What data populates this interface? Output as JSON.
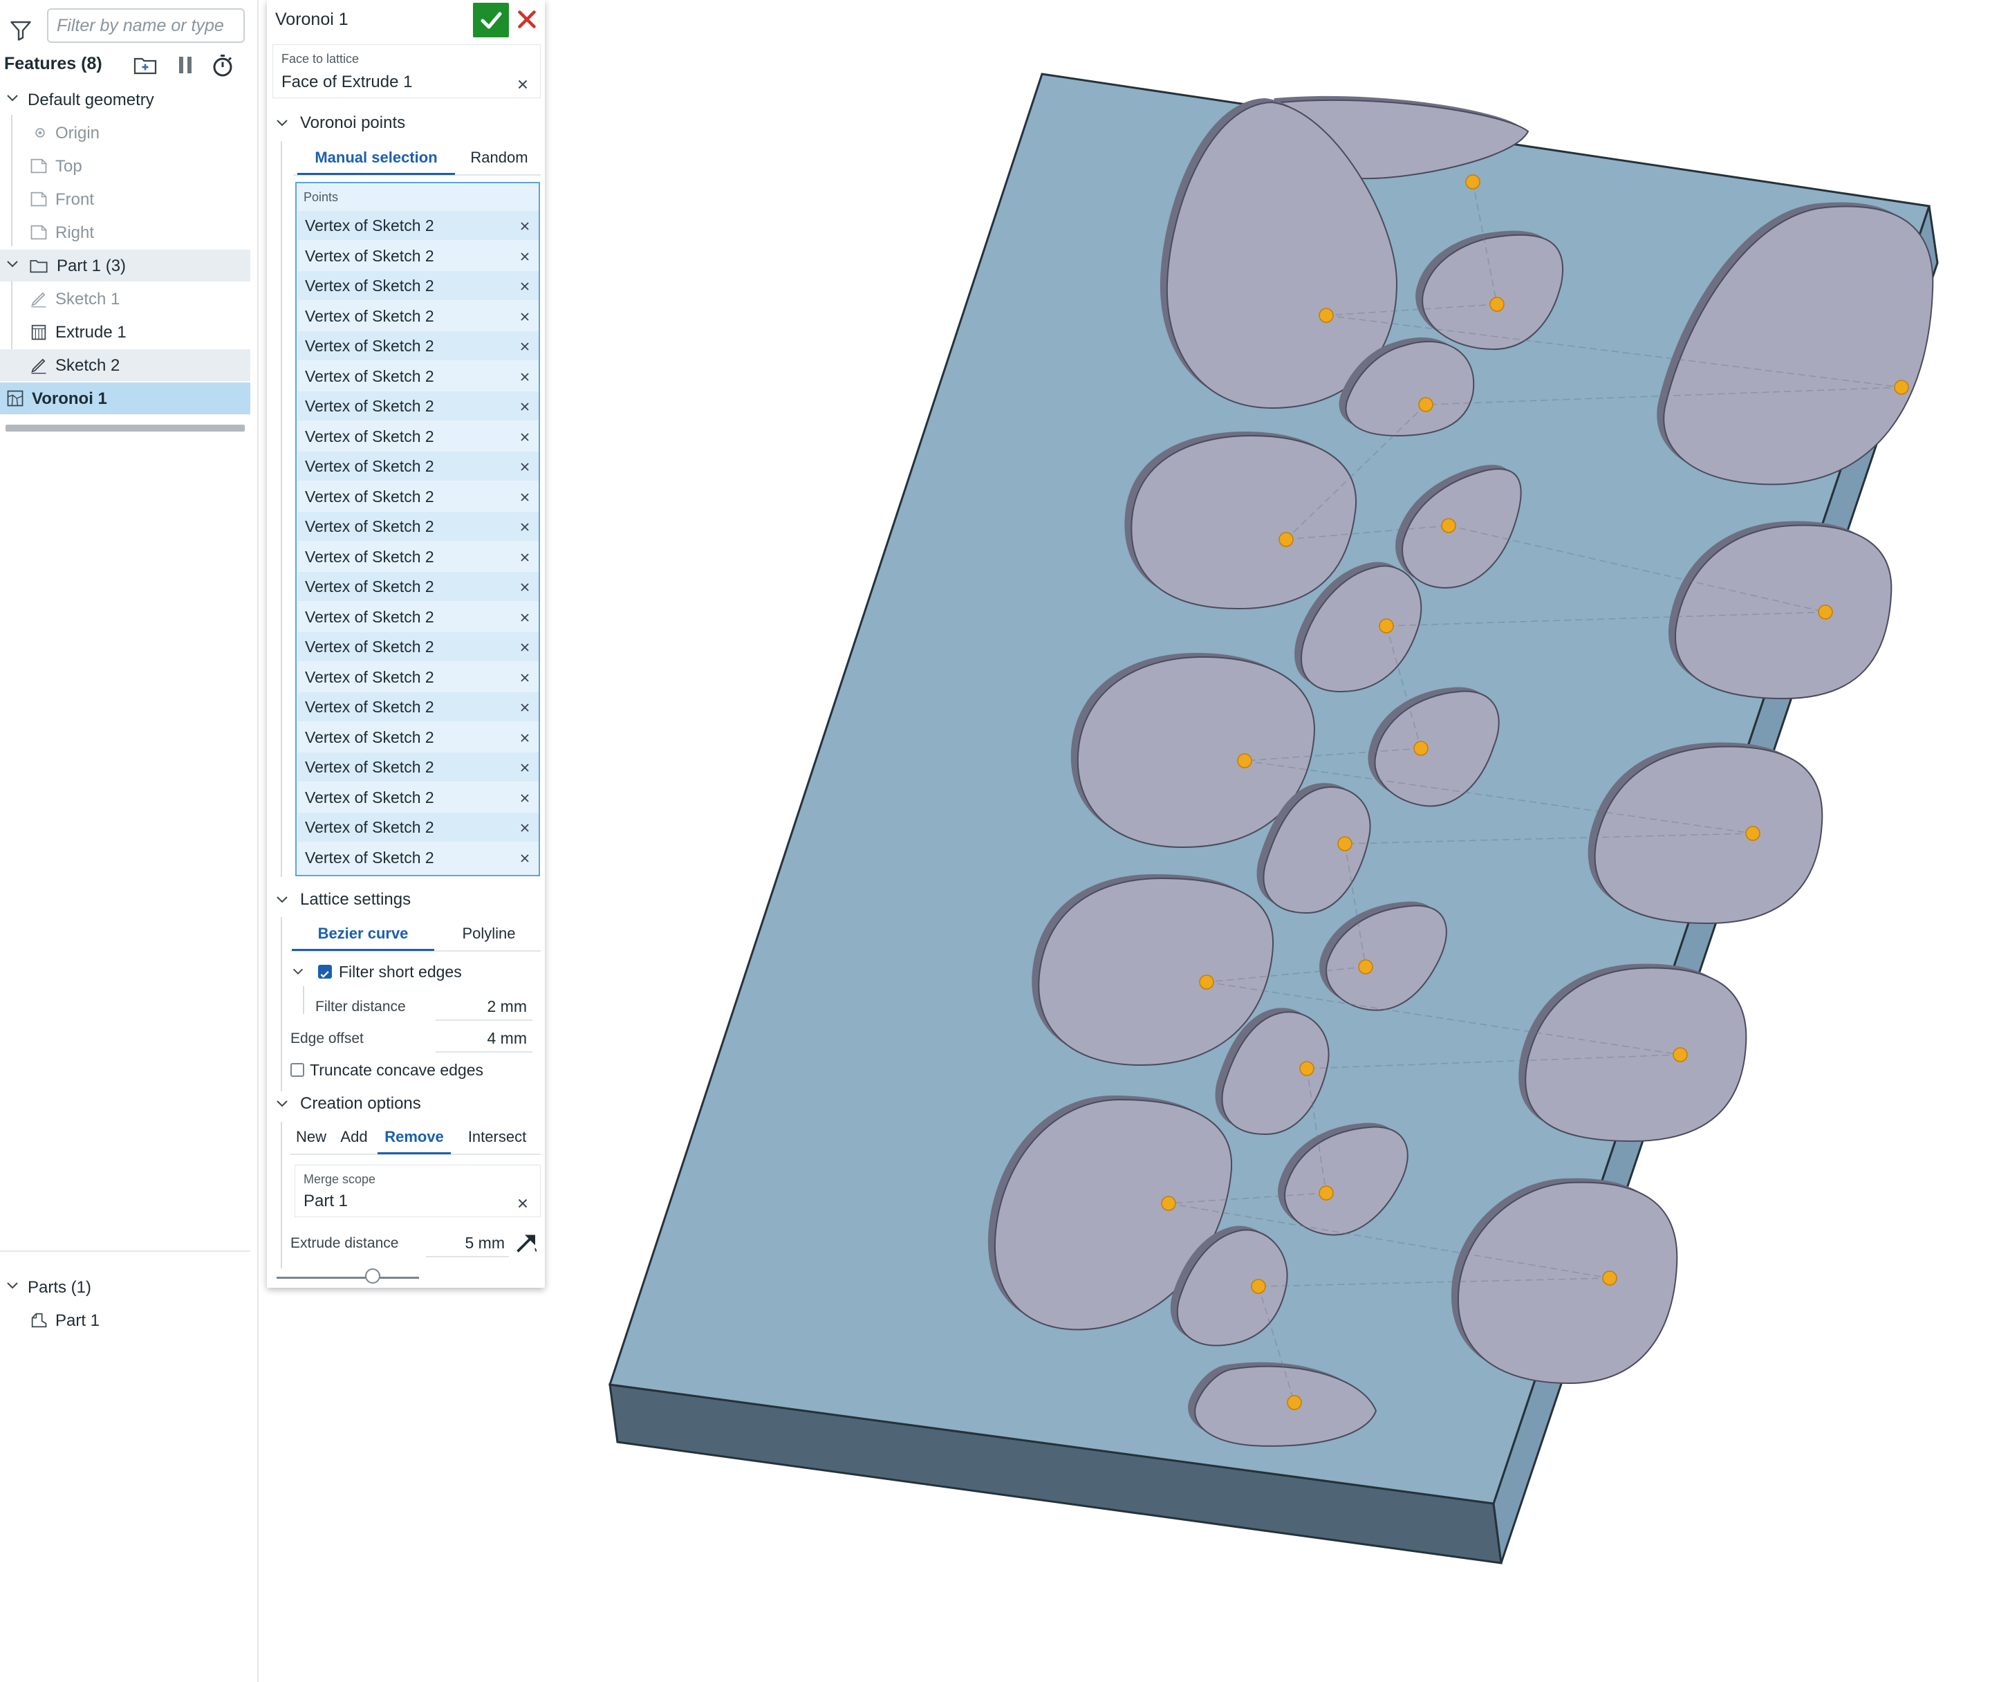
{
  "tree": {
    "filter_placeholder": "Filter by name or type",
    "features_title": "Features (8)",
    "default_geometry": "Default geometry",
    "origin": "Origin",
    "top": "Top",
    "front": "Front",
    "right": "Right",
    "part1_group": "Part 1 (3)",
    "sketch1": "Sketch 1",
    "extrude1": "Extrude 1",
    "sketch2": "Sketch 2",
    "voronoi1": "Voronoi 1",
    "parts_title": "Parts (1)",
    "part1": "Part 1"
  },
  "dialog": {
    "title": "Voronoi 1",
    "face_to_lattice_label": "Face to lattice",
    "face_to_lattice_value": "Face of Extrude 1",
    "voronoi_points_section": "Voronoi points",
    "tab_manual": "Manual selection",
    "tab_random": "Random",
    "points_label": "Points",
    "points": [
      "Vertex of Sketch 2",
      "Vertex of Sketch 2",
      "Vertex of Sketch 2",
      "Vertex of Sketch 2",
      "Vertex of Sketch 2",
      "Vertex of Sketch 2",
      "Vertex of Sketch 2",
      "Vertex of Sketch 2",
      "Vertex of Sketch 2",
      "Vertex of Sketch 2",
      "Vertex of Sketch 2",
      "Vertex of Sketch 2",
      "Vertex of Sketch 2",
      "Vertex of Sketch 2",
      "Vertex of Sketch 2",
      "Vertex of Sketch 2",
      "Vertex of Sketch 2",
      "Vertex of Sketch 2",
      "Vertex of Sketch 2",
      "Vertex of Sketch 2",
      "Vertex of Sketch 2",
      "Vertex of Sketch 2"
    ],
    "lattice_settings_section": "Lattice settings",
    "tab_bezier": "Bezier curve",
    "tab_polyline": "Polyline",
    "filter_short_edges": "Filter short edges",
    "filter_short_edges_checked": true,
    "filter_distance_label": "Filter distance",
    "filter_distance_value": "2 mm",
    "edge_offset_label": "Edge offset",
    "edge_offset_value": "4 mm",
    "truncate_concave": "Truncate concave edges",
    "truncate_concave_checked": false,
    "creation_options_section": "Creation options",
    "tab_new": "New",
    "tab_add": "Add",
    "tab_remove": "Remove",
    "tab_intersect": "Intersect",
    "merge_scope_label": "Merge scope",
    "merge_scope_value": "Part 1",
    "extrude_distance_label": "Extrude distance",
    "extrude_distance_value": "5 mm"
  },
  "colors": {
    "plate_top": "#8eafc4",
    "plate_side": "#7b9bb3",
    "plate_front": "#4f6575",
    "pocket": "#a8a9bd",
    "pocket_wall": "#6e6f82",
    "point": "#f0a91c",
    "ok_green": "#1c8f2b",
    "cancel_red": "#d0312d",
    "accent_blue": "#1b5fae",
    "selection_blue": "#b9dcf3"
  }
}
